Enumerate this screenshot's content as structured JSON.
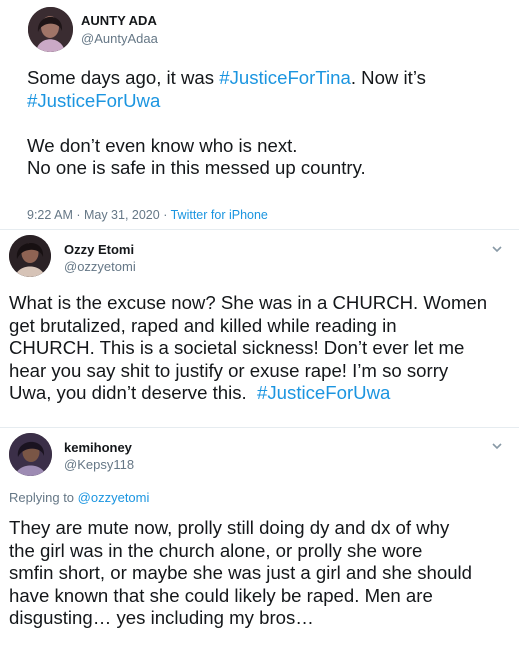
{
  "tweets": [
    {
      "name": "AUNTY ADA",
      "handle": "@AuntyAdaa",
      "lines": [
        {
          "pre": "Some days ago, it was ",
          "tag": "#JusticeForTina",
          "post": ". Now it’s"
        },
        {
          "pre": "",
          "tag": "#JusticeForUwa",
          "post": ""
        },
        {
          "pre": "We don’t even know who is next.",
          "tag": "",
          "post": ""
        },
        {
          "pre": "No one is safe in this messed up country.",
          "tag": "",
          "post": ""
        }
      ],
      "time": "9:22 AM · May 31, 2020 · ",
      "source": "Twitter for iPhone"
    },
    {
      "name": "Ozzy Etomi",
      "handle": "@ozzyetomi",
      "lines": [
        {
          "pre": "What is the excuse now? She was in a CHURCH. Women",
          "tag": "",
          "post": ""
        },
        {
          "pre": "get brutalized, raped and killed while reading in",
          "tag": "",
          "post": ""
        },
        {
          "pre": "CHURCH. This is a societal sickness! Don’t ever let me",
          "tag": "",
          "post": ""
        },
        {
          "pre": "hear you say shit to justify or exuse rape! I’m so sorry",
          "tag": "",
          "post": ""
        },
        {
          "pre": "Uwa, you didn’t deserve this.  ",
          "tag": "#JusticeForUwa",
          "post": ""
        }
      ]
    },
    {
      "name": "kemihoney",
      "handle": "@Kepsy118",
      "replying_label": "Replying to ",
      "replying_to": "@ozzyetomi",
      "lines": [
        {
          "pre": "They are mute now, prolly still doing dy and dx of why",
          "tag": "",
          "post": ""
        },
        {
          "pre": "the girl was in the church alone, or prolly she wore",
          "tag": "",
          "post": ""
        },
        {
          "pre": "smfin short, or maybe she was just a girl and she should",
          "tag": "",
          "post": ""
        },
        {
          "pre": "have known that she could likely be raped. Men are",
          "tag": "",
          "post": ""
        },
        {
          "pre": "disgusting… yes including my bros…",
          "tag": "",
          "post": ""
        }
      ]
    }
  ],
  "colors": {
    "link": "#1b95e0",
    "secondary": "#657786",
    "text": "#14171a",
    "divider": "#e6ecf0"
  },
  "icons": {
    "menu": "chevron-down-icon"
  }
}
